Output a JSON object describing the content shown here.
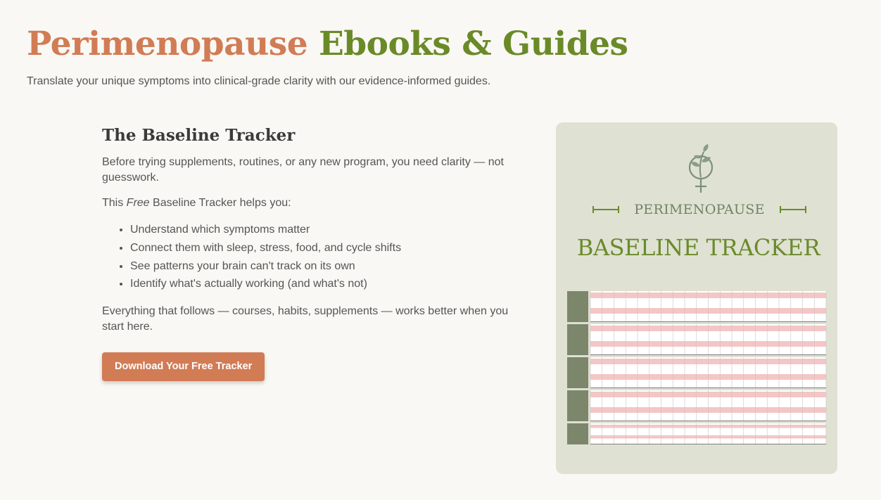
{
  "header": {
    "title_part1": "Perimenopause",
    "title_part2": "Ebooks & Guides",
    "subtitle": "Translate your unique symptoms into clinical-grade clarity with our evidence-informed guides."
  },
  "tracker_section": {
    "heading": "The Baseline Tracker",
    "intro": "Before trying supplements, routines, or any new program, you need clarity — not guesswork.",
    "helps_prefix": "This ",
    "helps_emphasis": "Free",
    "helps_suffix": " Baseline Tracker helps you:",
    "benefits": [
      "Understand which symptoms matter",
      "Connect them with sleep, stress, food, and cycle shifts",
      "See patterns your brain can't track on its own",
      "Identify what's actually working (and what's not)"
    ],
    "closing": "Everything that follows — courses, habits, supplements — works better when you start here.",
    "button_label": "Download Your Free Tracker"
  },
  "cover": {
    "eyebrow": "PERIMENOPAUSE",
    "title": "BASELINE TRACKER",
    "logo_icon": "leaf-venus-icon",
    "colors": {
      "background": "#dfe1d3",
      "accent_green": "#6b8a2a",
      "sidebar_green": "#7b866a",
      "row_pink": "#f4c6c6"
    },
    "tracker_week_blocks": 5,
    "tracker_day_columns": 20
  },
  "colors": {
    "terracotta": "#d17c55",
    "olive": "#6a8a28",
    "page_background": "#f9f8f4"
  }
}
